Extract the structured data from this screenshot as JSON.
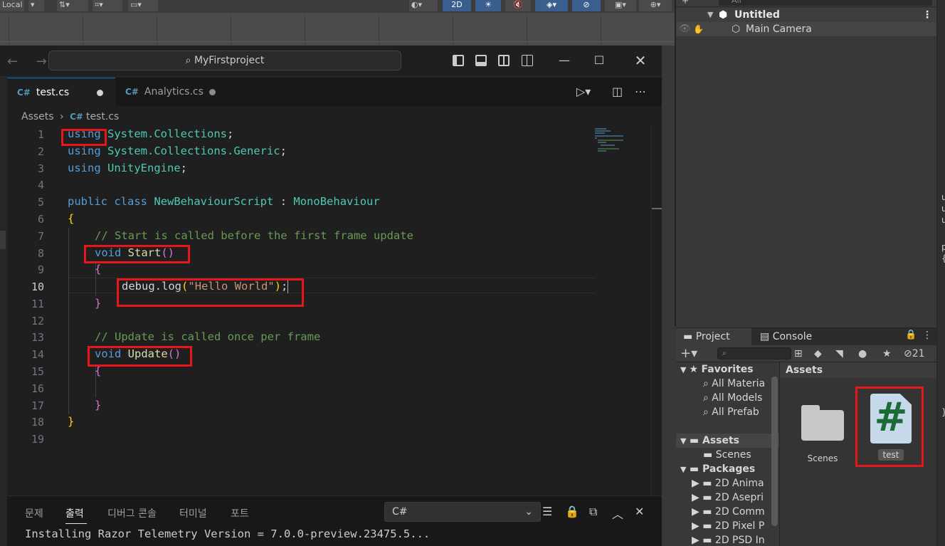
{
  "unity": {
    "toolbar": {
      "pivot_mode": "Local",
      "btn_2d": "2D"
    },
    "hierarchy": {
      "search_placeholder": "All",
      "scene_name": "Untitled",
      "objects": [
        "Main Camera"
      ]
    },
    "project": {
      "tab_project": "Project",
      "tab_console": "Console",
      "hidden_count": "21",
      "favorites_label": "Favorites",
      "favorites": [
        "All Materia",
        "All Models",
        "All Prefab"
      ],
      "assets_label": "Assets",
      "asset_folders": [
        "Scenes"
      ],
      "packages_label": "Packages",
      "packages": [
        "2D Anima",
        "2D Asepri",
        "2D Comm",
        "2D Pixel P",
        "2D PSD In"
      ],
      "grid_title": "Assets",
      "grid_items": [
        {
          "label": "Scenes",
          "kind": "folder"
        },
        {
          "label": "test",
          "kind": "csharp"
        }
      ]
    },
    "right_strip_chars": [
      "u",
      "u",
      "u",
      "p",
      "{",
      "}"
    ]
  },
  "vscode": {
    "nav_arrows": "← →",
    "command_center": "MyFirstproject",
    "tabs": [
      {
        "label": "test.cs",
        "active": true,
        "modified": true
      },
      {
        "label": "Analytics.cs",
        "active": false,
        "modified": true
      }
    ],
    "breadcrumb": {
      "folder": "Assets",
      "file": "test.cs"
    },
    "current_line": 10,
    "line_numbers": [
      "1",
      "2",
      "3",
      "4",
      "5",
      "6",
      "7",
      "8",
      "9",
      "10",
      "11",
      "12",
      "13",
      "14",
      "15",
      "16",
      "17",
      "18",
      "19"
    ],
    "code": {
      "l1": {
        "kw": "using",
        "ns": "System.Collections",
        "end": ";"
      },
      "l2": {
        "kw": "using",
        "ns": "System.Collections.Generic",
        "end": ";"
      },
      "l3": {
        "kw": "using",
        "ns": "UnityEngine",
        "end": ";"
      },
      "l5": {
        "kw1": "public",
        "kw2": "class",
        "name": "NewBehaviourScript",
        "colon": ":",
        "base": "MonoBehaviour"
      },
      "l6": "{",
      "l7": "// Start is called before the first frame update",
      "l8": {
        "kw": "void",
        "fn": "Start",
        "paren": "()"
      },
      "l9": "{",
      "l10": {
        "obj": "debug",
        "dot": ".",
        "fn": "log",
        "open": "(",
        "str": "\"Hello World\"",
        "close": ")",
        "end": ";"
      },
      "l11": "}",
      "l13": "// Update is called once per frame",
      "l14": {
        "kw": "void",
        "fn": "Update",
        "paren": "()"
      },
      "l15": "{",
      "l17": "}",
      "l18": "}"
    },
    "panel": {
      "tabs": [
        "문제",
        "출력",
        "디버그 콘솔",
        "터미널",
        "포트"
      ],
      "active_tab": "출력",
      "output_channel": "C#",
      "output_line": "Installing Razor Telemetry Version = 7.0.0-preview.23475.5..."
    },
    "colors": {
      "modified_dot": "#d4d4d4",
      "analytics_dot": "#8b8b8b",
      "highlight": "#e5161c"
    }
  }
}
